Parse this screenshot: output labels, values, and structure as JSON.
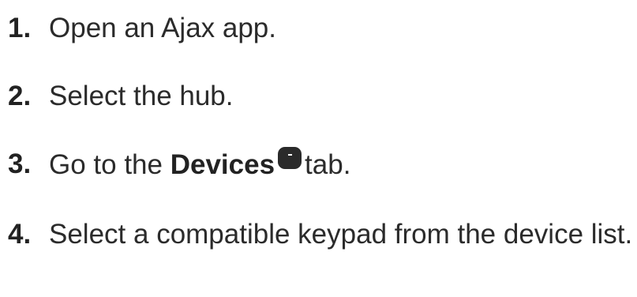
{
  "steps": [
    {
      "number": "1.",
      "text": "Open an Ajax app."
    },
    {
      "number": "2.",
      "text": "Select the hub."
    },
    {
      "number": "3.",
      "text_before": "Go to the",
      "bold": "Devices",
      "icon": "devices-tab-icon",
      "text_after": "tab."
    },
    {
      "number": "4.",
      "text": "Select a compatible keypad from the device list."
    }
  ]
}
